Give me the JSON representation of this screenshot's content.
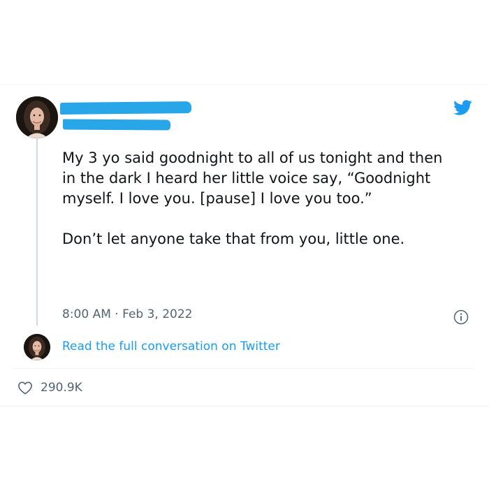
{
  "tweet": {
    "author_name_redacted": "",
    "author_handle_redacted": "",
    "paragraphs": [
      "My 3 yo said goodnight to all of us tonight and then in the dark I heard her little voice say, “Goodnight myself. I love you. [pause] I love you too.”",
      "Don’t let anyone take that from you, little one."
    ],
    "time": "8:00 AM",
    "separator": "·",
    "date": "Feb 3, 2022",
    "read_more_label": "Read the full conversation on Twitter",
    "likes": "290.9K"
  },
  "icons": {
    "logo": "twitter-bird-icon",
    "info": "info-icon",
    "like": "heart-icon"
  },
  "colors": {
    "brand_blue": "#1d9bf0",
    "redaction_blue": "#29a6e8",
    "text": "#0f1419",
    "muted": "#536471"
  }
}
